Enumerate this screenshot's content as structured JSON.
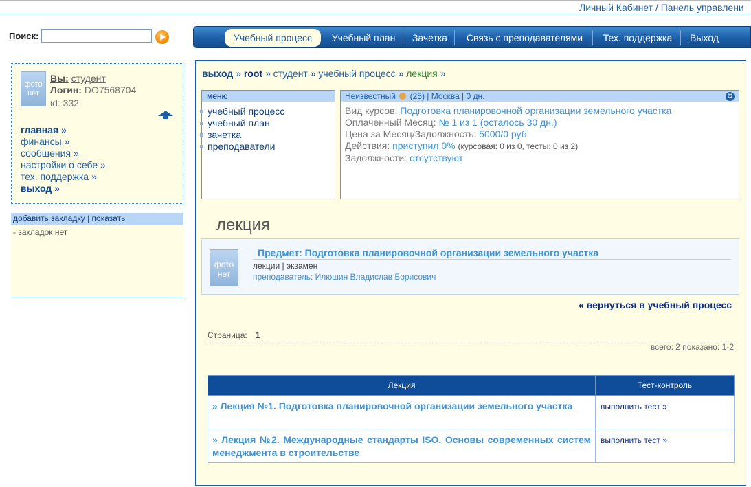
{
  "header": {
    "link": "Личный Кабинет / Панель управлени"
  },
  "search": {
    "label": "Поиск:",
    "value": "",
    "placeholder": ""
  },
  "nav": {
    "items": [
      {
        "label": "Учебный процесс",
        "active": true
      },
      {
        "label": "Учебный план"
      },
      {
        "label": "Зачетка"
      },
      {
        "label": "Связь с преподавателями"
      },
      {
        "label": "Тех. поддержка"
      },
      {
        "label": "Выход"
      }
    ]
  },
  "user": {
    "photo_text": "фото нет",
    "you_label": "Вы:",
    "you_value": "студент",
    "login_label": "Логин:",
    "login_value": "DO7568704",
    "id_text": "id: 332"
  },
  "sidebar": {
    "menu": [
      {
        "label": "главная »",
        "bold": true
      },
      {
        "label": "финансы »"
      },
      {
        "label": "сообщения »"
      },
      {
        "label": "настройки о себе »"
      },
      {
        "label": "тех. поддержка »"
      },
      {
        "label": "выход »",
        "bold": true
      }
    ]
  },
  "bookmarks": {
    "header": "добавить закладку | показать",
    "empty": "- закладок нет"
  },
  "breadcrumb": {
    "exit": "выход",
    "root": "root",
    "student": "студент",
    "process": "учебный процесс",
    "current": "лекция",
    "sep": "»"
  },
  "menu_box": {
    "header": "меню",
    "items": [
      "учебный процесс",
      "учебный план",
      "зачетка",
      "преподаватели"
    ]
  },
  "info": {
    "header_name": "Неизвестный",
    "header_rest": "(25) | Москва | 0 дн.",
    "course_label": "Вид курсов:",
    "course_value": "Подготовка планировочной организации земельного участка",
    "month_label": "Оплаченный Месяц:",
    "month_value": "№ 1 из 1 (осталось 30 дн.)",
    "price_label": "Цена за Месяц/Задолжность:",
    "price_value": "5000/0 руб.",
    "actions_label": "Действия:",
    "actions_value": "приступил 0%",
    "actions_note": "(курсовая: 0 из 0, тесты: 0 из 2)",
    "debt_label": "Задолжности:",
    "debt_value": "отсутствуют"
  },
  "page_title": "лекция",
  "subject": {
    "photo_text": "фото нет",
    "title": "Предмет: Подготовка планировочной организации земельного участка",
    "kind": "лекции | экзамен",
    "teacher": "преподаватель: Илюшин Владислав Борисович"
  },
  "back_link": "« вернуться в учебный процесс",
  "pager": {
    "label": "Страница:",
    "page": "1",
    "total": "всего: 2 показано: 1-2"
  },
  "table": {
    "col_lecture": "Лекция",
    "col_test": "Тест-контроль",
    "rows": [
      {
        "lecture": "» Лекция №1. Подготовка планировочной организации земельного участка",
        "test": "выполнить тест »"
      },
      {
        "lecture": "» Лекция №2. Международные стандарты ISO. Основы современных систем менеджмента в строительстве",
        "test": "выполнить тест »"
      }
    ]
  }
}
